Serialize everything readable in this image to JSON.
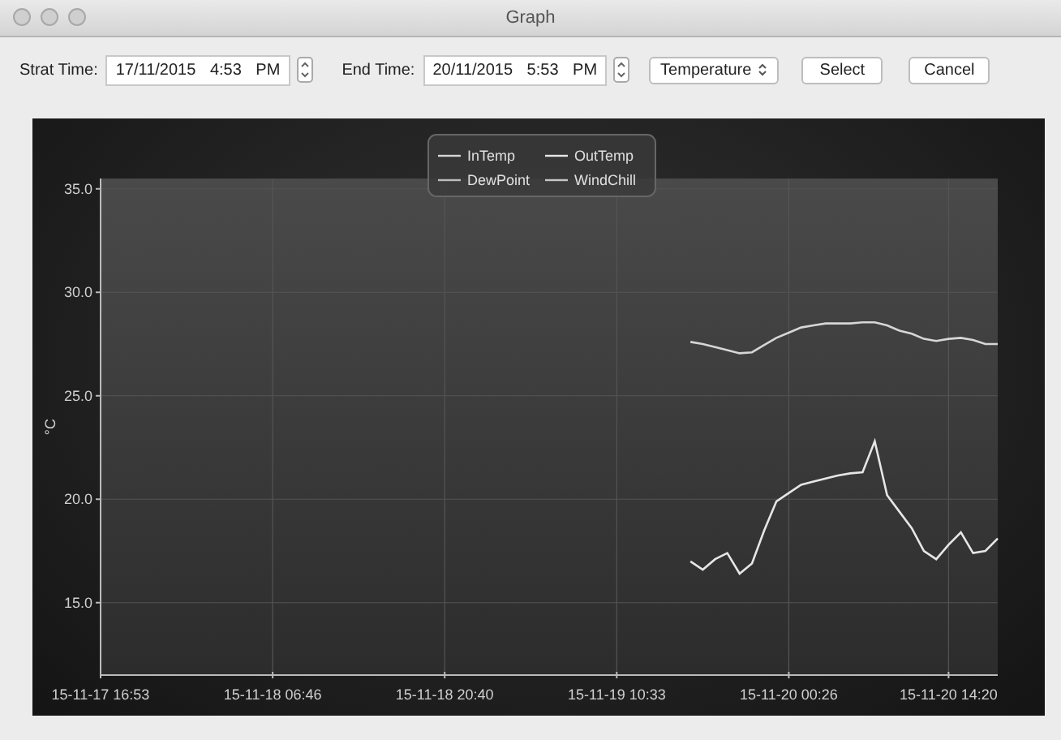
{
  "window": {
    "title": "Graph"
  },
  "toolbar": {
    "start_label": "Strat Time:",
    "start_value": "17/11/2015 4:53 PM",
    "end_label": "End Time:",
    "end_value": "20/11/2015 5:53 PM",
    "measure": "Temperature",
    "buttons": [
      "Select",
      "Cancel"
    ]
  },
  "chart": {
    "chart_data": {
      "type": "line",
      "ylabel": "°C",
      "grid": true,
      "legend": "top",
      "categories": [
        "15-11-17 16:53",
        null,
        null,
        null,
        null,
        null,
        null,
        null,
        null,
        null,
        null,
        null,
        null,
        null,
        "15-11-18 06:46",
        null,
        null,
        null,
        null,
        null,
        null,
        null,
        null,
        null,
        null,
        null,
        null,
        null,
        "15-11-18 20:40",
        null,
        null,
        null,
        null,
        null,
        null,
        null,
        null,
        null,
        null,
        null,
        null,
        null,
        "15-11-19 10:33",
        null,
        null,
        null,
        null,
        null,
        null,
        null,
        null,
        null,
        null,
        null,
        null,
        null,
        "15-11-20 00:26",
        null,
        null,
        null,
        null,
        null,
        null,
        null,
        null,
        null,
        null,
        null,
        null,
        "15-11-20 14:20",
        null,
        null,
        null,
        null
      ],
      "series": [
        {
          "name": "InTemp",
          "color": "#d6d6d6",
          "values": [
            null,
            null,
            null,
            null,
            null,
            null,
            null,
            null,
            null,
            null,
            null,
            null,
            null,
            null,
            null,
            null,
            null,
            null,
            null,
            null,
            null,
            null,
            null,
            null,
            null,
            null,
            null,
            null,
            null,
            null,
            null,
            null,
            null,
            null,
            null,
            null,
            null,
            null,
            null,
            null,
            null,
            null,
            null,
            null,
            null,
            null,
            null,
            null,
            27.6,
            27.5,
            27.35,
            27.2,
            27.05,
            27.1,
            27.45,
            27.8,
            28.05,
            28.3,
            28.4,
            28.5,
            28.5,
            28.5,
            28.55,
            28.55,
            28.4,
            28.15,
            28.0,
            27.75,
            27.65,
            27.75,
            27.8,
            27.7,
            27.5,
            27.5
          ]
        },
        {
          "name": "OutTemp",
          "color": "#e6e6e6",
          "values": [
            null,
            null,
            null,
            null,
            null,
            null,
            null,
            null,
            null,
            null,
            null,
            null,
            null,
            null,
            null,
            null,
            null,
            null,
            null,
            null,
            null,
            null,
            null,
            null,
            null,
            null,
            null,
            null,
            null,
            null,
            null,
            null,
            null,
            null,
            null,
            null,
            null,
            null,
            null,
            null,
            null,
            null,
            null,
            null,
            null,
            null,
            null,
            null,
            17.0,
            16.6,
            17.1,
            17.4,
            16.4,
            16.9,
            18.5,
            19.9,
            20.3,
            20.7,
            20.85,
            21.0,
            21.15,
            21.25,
            21.3,
            22.8,
            20.2,
            19.4,
            18.6,
            17.5,
            17.1,
            17.8,
            18.4,
            17.4,
            17.5,
            18.1
          ]
        },
        {
          "name": "DewPoint",
          "color": "#bdbdbd",
          "values": [
            null,
            null,
            null,
            null,
            null,
            null,
            null,
            null,
            null,
            null,
            null,
            null,
            null,
            null,
            null,
            null,
            null,
            null,
            null,
            null,
            null,
            null,
            null,
            null,
            null,
            null,
            null,
            null,
            null,
            null,
            null,
            null,
            null,
            null,
            null,
            null,
            null,
            null,
            null,
            null,
            null,
            null,
            null,
            null,
            null,
            null,
            null,
            null,
            null,
            null,
            null,
            null,
            null,
            null,
            null,
            null,
            null,
            null,
            null,
            null,
            null,
            null,
            null,
            null,
            null,
            null,
            null,
            null,
            null,
            null,
            null,
            null,
            null,
            null
          ]
        },
        {
          "name": "WindChill",
          "color": "#c8c8c8",
          "values": [
            null,
            null,
            null,
            null,
            null,
            null,
            null,
            null,
            null,
            null,
            null,
            null,
            null,
            null,
            null,
            null,
            null,
            null,
            null,
            null,
            null,
            null,
            null,
            null,
            null,
            null,
            null,
            null,
            null,
            null,
            null,
            null,
            null,
            null,
            null,
            null,
            null,
            null,
            null,
            null,
            null,
            null,
            null,
            null,
            null,
            null,
            null,
            null,
            null,
            null,
            null,
            null,
            null,
            null,
            null,
            null,
            null,
            null,
            null,
            null,
            null,
            null,
            null,
            null,
            null,
            null,
            null,
            null,
            null,
            null,
            null,
            null,
            null,
            null
          ]
        }
      ],
      "ylim": [
        11.5,
        35.5
      ],
      "yticks": [
        {
          "value": 15,
          "label": "15.0"
        },
        {
          "value": 20,
          "label": "20.0"
        },
        {
          "value": 25,
          "label": "25.0"
        },
        {
          "value": 30,
          "label": "30.0"
        },
        {
          "value": 35,
          "label": "35.0"
        }
      ]
    }
  }
}
